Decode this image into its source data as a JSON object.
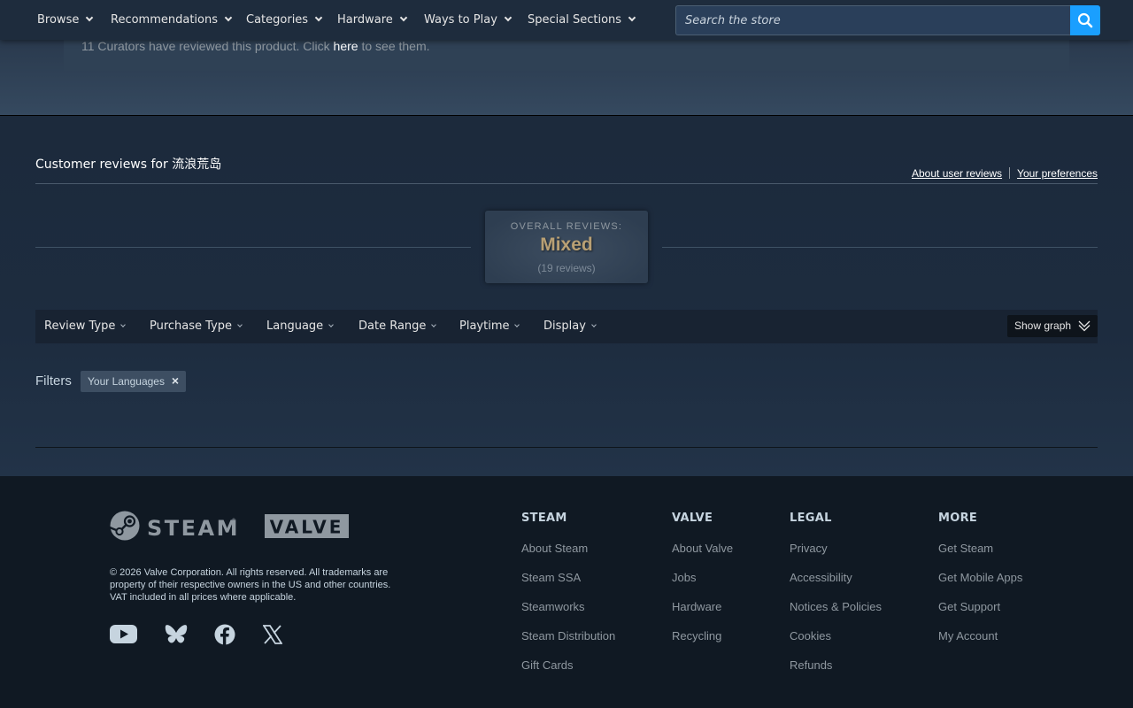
{
  "nav": {
    "items": [
      "Browse",
      "Recommendations",
      "Categories",
      "Hardware",
      "Ways to Play",
      "Special Sections"
    ],
    "search_placeholder": "Search the store"
  },
  "curator": {
    "prefix": "11 Curators have reviewed this product. Click ",
    "link": "here",
    "suffix": " to see them."
  },
  "reviews": {
    "heading": "Customer reviews for 流浪荒岛",
    "about_link": "About user reviews",
    "prefs_link": "Your preferences",
    "overall_label": "OVERALL REVIEWS:",
    "overall_value": "Mixed",
    "overall_count": "(19 reviews)",
    "filters": [
      "Review Type",
      "Purchase Type",
      "Language",
      "Date Range",
      "Playtime",
      "Display"
    ],
    "show_graph": "Show graph",
    "filters_label": "Filters",
    "chip_label": "Your Languages",
    "chip_close": "×"
  },
  "footer": {
    "steam_logo_text": "STEAM",
    "valve_logo_text": "VALVE",
    "copyright": "© 2026 Valve Corporation. All rights reserved. All trademarks are property of their respective owners in the US and other countries. VAT included in all prices where applicable.",
    "social": [
      "youtube-icon",
      "bluesky-icon",
      "facebook-icon",
      "x-icon"
    ],
    "columns": [
      {
        "title": "STEAM",
        "links": [
          "About Steam",
          "Steam SSA",
          "Steamworks",
          "Steam Distribution",
          "Gift Cards"
        ]
      },
      {
        "title": "VALVE",
        "links": [
          "About Valve",
          "Jobs",
          "Hardware",
          "Recycling"
        ]
      },
      {
        "title": "LEGAL",
        "links": [
          "Privacy",
          "Accessibility",
          "Notices & Policies",
          "Cookies",
          "Refunds"
        ]
      },
      {
        "title": "MORE",
        "links": [
          "Get Steam",
          "Get Mobile Apps",
          "Get Support",
          "My Account"
        ]
      }
    ]
  },
  "colors": {
    "accent": "#1a9fff",
    "mixed": "#b9a074",
    "background": "#1b2838",
    "footer": "#101923"
  }
}
